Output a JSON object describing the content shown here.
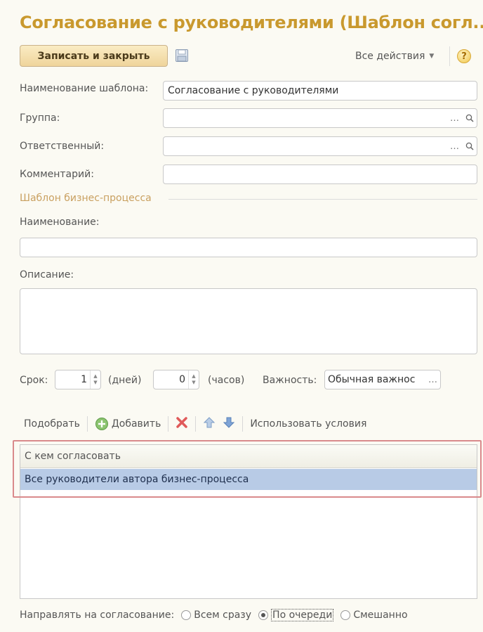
{
  "form": {
    "title": "Согласование с руководителями (Шаблон согл..."
  },
  "toolbar": {
    "save_close_label": "Записать и закрыть",
    "all_actions_label": "Все действия",
    "help_label": "?"
  },
  "fields": {
    "template_name_label": "Наименование шаблона:",
    "template_name_value": "Согласование с руководителями",
    "group_label": "Группа:",
    "group_value": "",
    "responsible_label": "Ответственный:",
    "responsible_value": "",
    "comment_label": "Комментарий:",
    "comment_value": ""
  },
  "bp": {
    "group_title": "Шаблон бизнес-процесса",
    "name_label": "Наименование:",
    "name_value": "",
    "desc_label": "Описание:",
    "desc_value": "",
    "term_label": "Срок:",
    "days_value": "1",
    "days_unit": "(дней)",
    "hours_value": "0",
    "hours_unit": "(часов)",
    "importance_label": "Важность:",
    "importance_value": "Обычная важнос"
  },
  "table_toolbar": {
    "pick_label": "Подобрать",
    "add_label": "Добавить",
    "use_conditions_label": "Использовать условия"
  },
  "table": {
    "column_header": "С кем согласовать",
    "rows": [
      "Все руководители автора бизнес-процесса"
    ]
  },
  "routing": {
    "label": "Направлять на согласование:",
    "options": [
      "Всем сразу",
      "По очереди",
      "Смешанно"
    ],
    "selected": "По очереди"
  },
  "colors": {
    "title": "#c9992e",
    "selected_row": "#b8cbe6",
    "highlight_border": "#d98a8c"
  }
}
